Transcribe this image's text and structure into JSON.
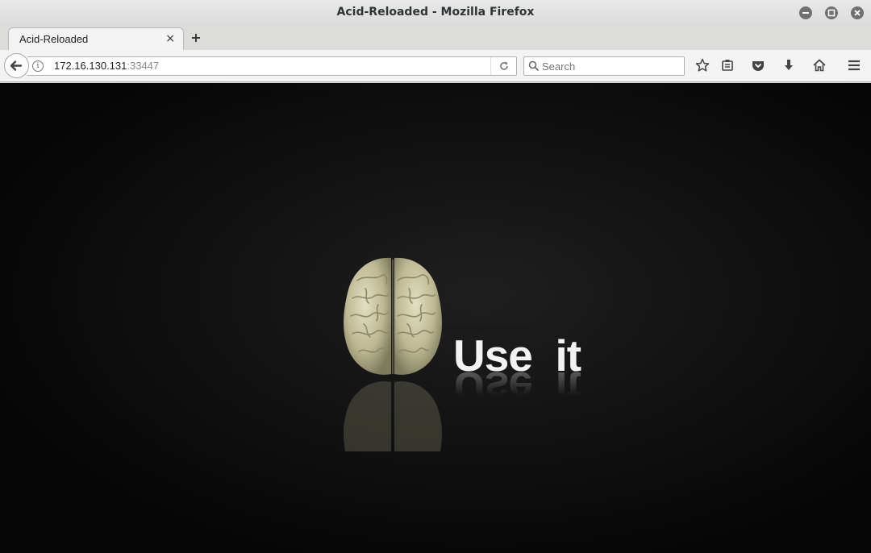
{
  "window": {
    "title": "Acid-Reloaded - Mozilla Firefox",
    "controls": {
      "minimize": "–",
      "maximize": "□",
      "close": "×"
    }
  },
  "tabs": [
    {
      "label": "Acid-Reloaded",
      "close": "×",
      "active": true
    }
  ],
  "new_tab_label": "+",
  "navigation": {
    "url_host": "172.16.130.131",
    "url_port": ":33447",
    "search_placeholder": "Search",
    "icons": [
      "back-icon",
      "info-icon",
      "reload-icon",
      "search-icon",
      "bookmark-star-icon",
      "reading-list-icon",
      "pocket-icon",
      "download-icon",
      "home-icon",
      "menu-icon"
    ]
  },
  "page": {
    "headline": "Use  it",
    "image": "brain-icon"
  },
  "colors": {
    "content_background": "#0a0a0a",
    "headline": "#f2f2f2",
    "brain": "#c9c6a6"
  }
}
